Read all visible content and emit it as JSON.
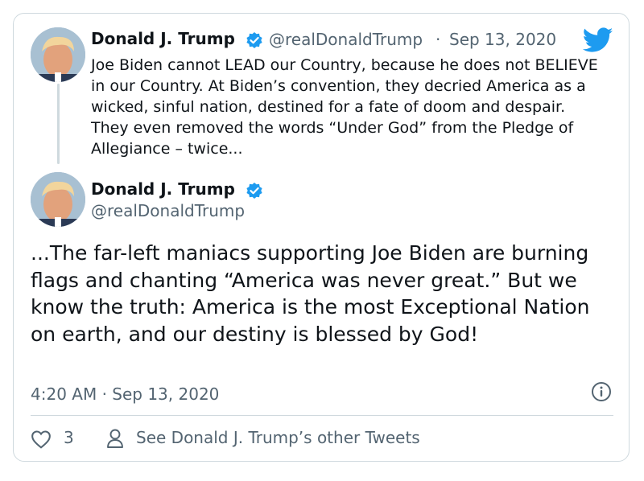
{
  "quoted_tweet": {
    "author_name": "Donald J. Trump",
    "handle": "@realDonaldTrump",
    "separator": "·",
    "date": "Sep 13, 2020",
    "text": "Joe Biden cannot LEAD our Country, because he does not BELIEVE in our Country. At Biden’s convention, they decried America as a wicked, sinful nation, destined for a fate of doom and despair. They even removed the words “Under God” from the Pledge of Allegiance – twice..."
  },
  "main_tweet": {
    "author_name": "Donald J. Trump",
    "handle": "@realDonaldTrump",
    "text": "...The far-left maniacs supporting Joe Biden are burning flags and chanting “America was never great.” But we know the truth: America is the most Exceptional Nation on earth, and our destiny is blessed by God!",
    "timestamp": "4:20 AM · Sep 13, 2020"
  },
  "actions": {
    "like_count": "3",
    "other_tweets_label": "See Donald J. Trump’s other Tweets"
  },
  "icons": {
    "brand": "twitter-bird-icon",
    "verified": "verified-badge-icon",
    "info": "info-icon",
    "like": "heart-icon",
    "profile": "person-icon"
  },
  "colors": {
    "verified_blue": "#1d9bf0",
    "twitter_blue": "#1d9bf0",
    "text": "#0f1419",
    "secondary_text": "#536471",
    "border": "#cfd9de"
  }
}
